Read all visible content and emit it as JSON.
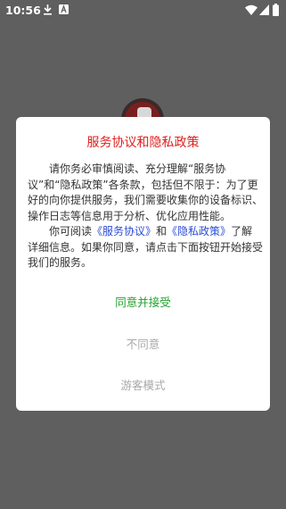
{
  "status_bar": {
    "time": "10:56",
    "icons": [
      "download-icon",
      "a-icon",
      "wifi-icon",
      "signal-icon",
      "battery-icon"
    ]
  },
  "dialog": {
    "title": "服务协议和隐私政策",
    "paragraph1": "请你务必审慎阅读、充分理解“服务协议”和“隐私政策”各条款，包括但不限于：为了更好的向你提供服务，我们需要收集你的设备标识、操作日志等信息用于分析、优化应用性能。",
    "paragraph2_prefix": "你可阅读",
    "service_link": "《服务协议》",
    "and_text": "和",
    "privacy_link": "《隐私政策》",
    "paragraph2_suffix": "了解详细信息。如果你同意，请点击下面按钮开始接受我们的服务。",
    "agree_button": "同意并接受",
    "disagree_button": "不同意",
    "guest_button": "游客模式"
  },
  "colors": {
    "title": "#e02020",
    "link": "#2b4cd6",
    "agree": "#20a02a",
    "muted": "#a8a8a8",
    "overlay": "#5f5f5f"
  }
}
